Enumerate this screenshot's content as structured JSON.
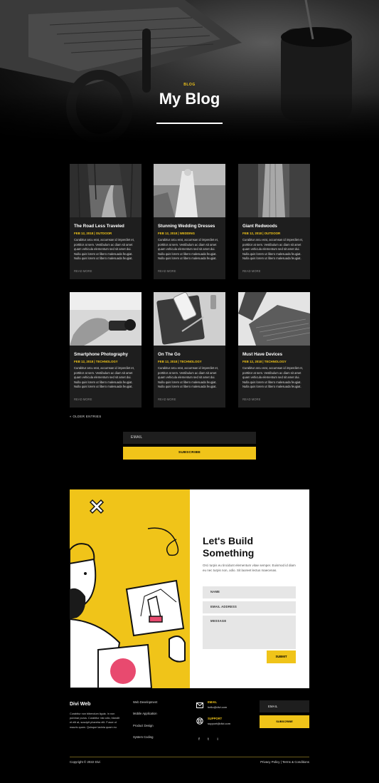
{
  "hero": {
    "kicker": "BLOG",
    "title": "My Blog"
  },
  "posts": [
    {
      "title": "The Road Less Traveled",
      "meta": "FEB 12, 2018 | OUTDOOR",
      "excerpt": "Curabitur arcu erat, accumsan id imperdiet et, porttitor at sem. Vestibulum ac diam sit amet quam vehicula elementum sed sit amet dui. Nulla quis lorem ut libero malesuada feugiat. Nulla quis lorem ut libero malesuada feugiat.",
      "more": "READ MORE",
      "image": "forest-path-photo"
    },
    {
      "title": "Stunning Wedding Dresses",
      "meta": "FEB 12, 2018 | WEDDING",
      "excerpt": "Curabitur arcu erat, accumsan id imperdiet et, porttitor at sem. Vestibulum ac diam sit amet quam vehicula elementum sed sit amet dui. Nulla quis lorem ut libero malesuada feugiat. Nulla quis lorem ut libero malesuada feugiat.",
      "more": "READ MORE",
      "image": "wedding-dress-photo"
    },
    {
      "title": "Giant Redwoods",
      "meta": "FEB 12, 2018 | OUTDOOR",
      "excerpt": "Curabitur arcu erat, accumsan id imperdiet et, porttitor at sem. Vestibulum ac diam sit amet quam vehicula elementum sed sit amet dui. Nulla quis lorem ut libero malesuada feugiat. Nulla quis lorem ut libero malesuada feugiat.",
      "more": "READ MORE",
      "image": "redwood-tree-photo"
    },
    {
      "title": "Smartphone Photography",
      "meta": "FEB 12, 2018 | TECHNOLOGY",
      "excerpt": "Curabitur arcu erat, accumsan id imperdiet et, porttitor at sem. Vestibulum ac diam sit amet quam vehicula elementum sed sit amet dui. Nulla quis lorem ut libero malesuada feugiat. Nulla quis lorem ut libero malesuada feugiat.",
      "more": "READ MORE",
      "image": "hand-camera-photo"
    },
    {
      "title": "On The Go",
      "meta": "FEB 12, 2018 | TECHNOLOGY",
      "excerpt": "Curabitur arcu erat, accumsan id imperdiet et, porttitor at sem. Vestibulum ac diam sit amet quam vehicula elementum sed sit amet dui. Nulla quis lorem ut libero malesuada feugiat. Nulla quis lorem ut libero malesuada feugiat.",
      "more": "READ MORE",
      "image": "phone-notebook-photo"
    },
    {
      "title": "Must Have Devices",
      "meta": "FEB 12, 2018 | TECHNOLOGY",
      "excerpt": "Curabitur arcu erat, accumsan id imperdiet et, porttitor at sem. Vestibulum ac diam sit amet quam vehicula elementum sed sit amet dui. Nulla quis lorem ut libero malesuada feugiat. Nulla quis lorem ut libero malesuada feugiat.",
      "more": "READ MORE",
      "image": "laptop-keyboard-photo"
    }
  ],
  "pagination": {
    "older": "« OLDER ENTRIES"
  },
  "subscribe": {
    "email_placeholder": "EMAIL",
    "button": "SUBSCRIBE"
  },
  "contact": {
    "heading": "Let's Build Something",
    "text": "Orci turpis eu tincidunt elementum vitae semper. Euismod id diam eu nec turpis non, odio. Sit laoreet lectus maecenas.",
    "fields": {
      "name": "NAME",
      "email": "EMAIL ADDRESS",
      "message": "MESSAGE"
    },
    "submit": "SUBMIT"
  },
  "footer": {
    "brand": "Divi Web",
    "description": "Curabitur non bibendum ligula. In non pulvinar purus. Curabitur nisi odio, blandit et elit at, suscipit pharetra elit. Fusce ut mauris quam. Quisque lacinia quam eu",
    "links": [
      "Web Development",
      "Mobile Application",
      "Product Design",
      "System Coding"
    ],
    "contact_email_label": "EMAIL",
    "contact_email_value": "hello@divi.com",
    "contact_support_label": "SUPPORT",
    "contact_support_value": "support@divi.com",
    "social": [
      "f",
      "t",
      "i"
    ],
    "email_placeholder": "EMAIL",
    "subscribe": "SUBSCRIBE",
    "copyright": "Copyright © 2022 Divi",
    "legal": "Privacy Policy | Terms & Conditions"
  },
  "colors": {
    "accent": "#f0c419",
    "background": "#000000",
    "card": "#1e1e1e"
  }
}
